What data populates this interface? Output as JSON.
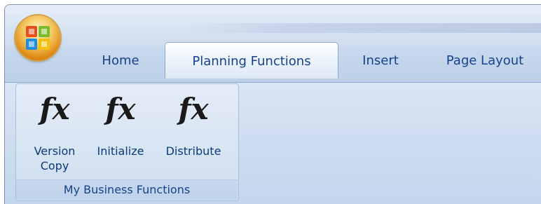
{
  "ribbon": {
    "tabs": [
      {
        "label": "Home",
        "active": false
      },
      {
        "label": "Planning Functions",
        "active": true
      },
      {
        "label": "Insert",
        "active": false
      },
      {
        "label": "Page Layout",
        "active": false
      }
    ],
    "group": {
      "label": "My Business Functions",
      "buttons": [
        {
          "icon": "function-fx-icon",
          "glyph": "fx",
          "label_line1": "Version",
          "label_line2": "Copy"
        },
        {
          "icon": "function-fx-icon",
          "glyph": "fx",
          "label_line1": "Initialize",
          "label_line2": ""
        },
        {
          "icon": "function-fx-icon",
          "glyph": "fx",
          "label_line1": "Distribute",
          "label_line2": ""
        }
      ]
    }
  },
  "colors": {
    "tab_text": "#15428b",
    "ribbon_bg": "#cfdef0",
    "office_button": "#e08d18"
  }
}
